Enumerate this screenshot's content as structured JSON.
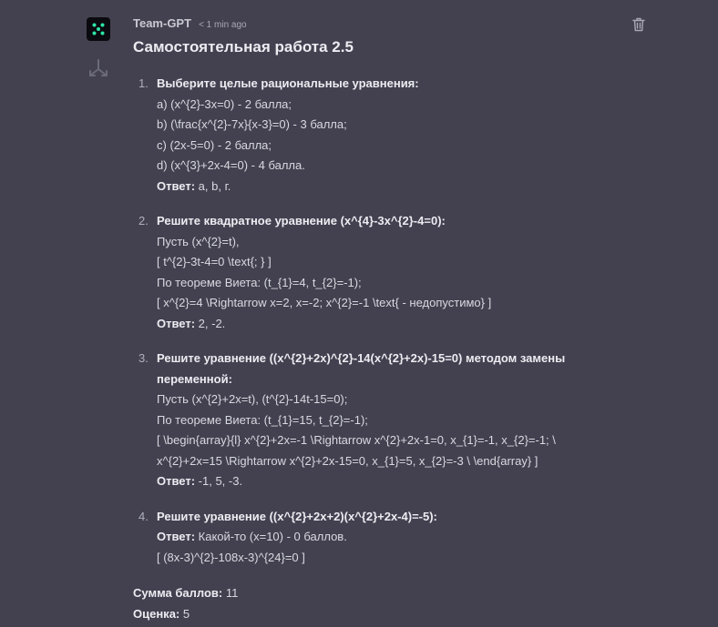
{
  "header": {
    "author": "Team-GPT",
    "time": "< 1 min ago"
  },
  "title": "Самостоятельная работа 2.5",
  "items": [
    {
      "num": "1.",
      "question": "Выберите целые рациональные уравнения:",
      "lines": [
        "a) (x^{2}-3x=0) - 2 балла;",
        "b) (\\frac{x^{2}-7x}{x-3}=0) - 3 балла;",
        "c) (2x-5=0) - 2 балла;",
        "d) (x^{3}+2x-4=0) - 4 балла."
      ],
      "answer_label": "Ответ:",
      "answer_value": " a, b, г."
    },
    {
      "num": "2.",
      "question": "Решите квадратное уравнение (x^{4}-3x^{2}-4=0):",
      "lines": [
        "Пусть (x^{2}=t),",
        "[ t^{2}-3t-4=0 \\text{; } ]",
        "По теореме Виета: (t_{1}=4, t_{2}=-1);",
        "[ x^{2}=4 \\Rightarrow x=2, x=-2; x^{2}=-1 \\text{ - недопустимо} ]"
      ],
      "answer_label": "Ответ:",
      "answer_value": " 2, -2."
    },
    {
      "num": "3.",
      "question": "Решите уравнение ((x^{2}+2x)^{2}-14(x^{2}+2x)-15=0) методом замены переменной:",
      "lines": [
        "Пусть (x^{2}+2x=t), (t^{2}-14t-15=0);",
        "По теореме Виета: (t_{1}=15, t_{2}=-1);",
        "[ \\begin{array}{l} x^{2}+2x=-1 \\Rightarrow x^{2}+2x-1=0, x_{1}=-1, x_{2}=-1; \\ x^{2}+2x=15 \\Rightarrow x^{2}+2x-15=0, x_{1}=5, x_{2}=-3 \\ \\end{array} ]"
      ],
      "answer_label": "Ответ:",
      "answer_value": " -1, 5, -3."
    },
    {
      "num": "4.",
      "question": "Решите уравнение ((x^{2}+2x+2)(x^{2}+2x-4)=-5):",
      "answer_label": "Ответ:",
      "answer_value": " Какой-то (x=10) - 0 баллов.",
      "after": "[ (8x-3)^{2}-108x-3)^{24}=0 ]"
    }
  ],
  "summary": {
    "sum_label": "Сумма баллов:",
    "sum_value": " 11",
    "grade_label": "Оценка:",
    "grade_value": " 5"
  },
  "colors": {
    "background": "#434150",
    "avatar_dots": "#2ee6a6"
  },
  "icons": [
    "team-gpt-logo-icon",
    "fork-icon",
    "trash-icon"
  ]
}
